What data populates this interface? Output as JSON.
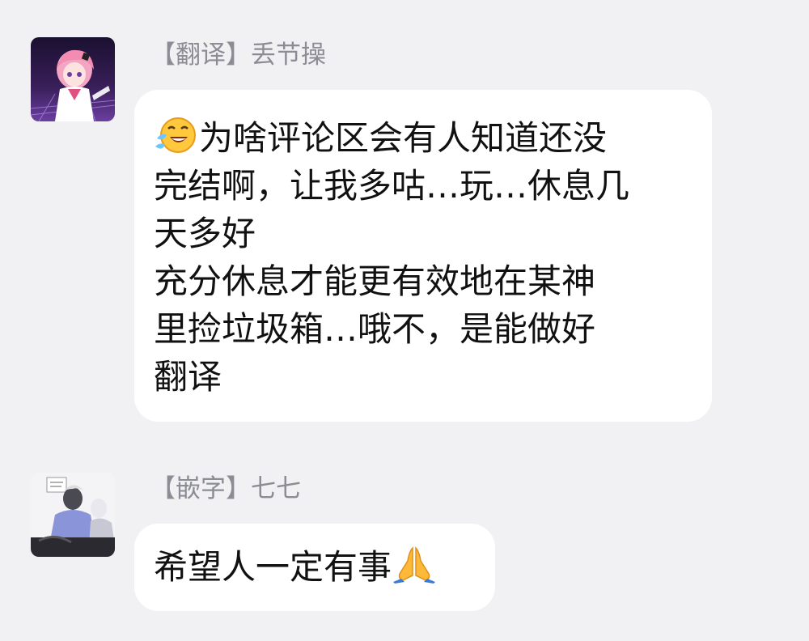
{
  "messages": [
    {
      "sender": "【翻译】丢节操",
      "avatar": "anime-pink-hair-avatar",
      "emoji": "laugh-crying-face",
      "lines": [
        "为啥评论区会有人知道还没",
        "完结啊，让我多咕…玩…休息几",
        "天多好",
        "充分休息才能更有效地在某神",
        "里捡垃圾箱…哦不，是能做好",
        "翻译"
      ]
    },
    {
      "sender": "【嵌字】七七",
      "avatar": "manga-characters-avatar",
      "text": "希望人一定有事",
      "emoji": "folded-hands"
    }
  ],
  "colors": {
    "background": "#f1f1f4",
    "bubble": "#ffffff",
    "sender_text": "#8c8c94",
    "message_text": "#111111"
  }
}
